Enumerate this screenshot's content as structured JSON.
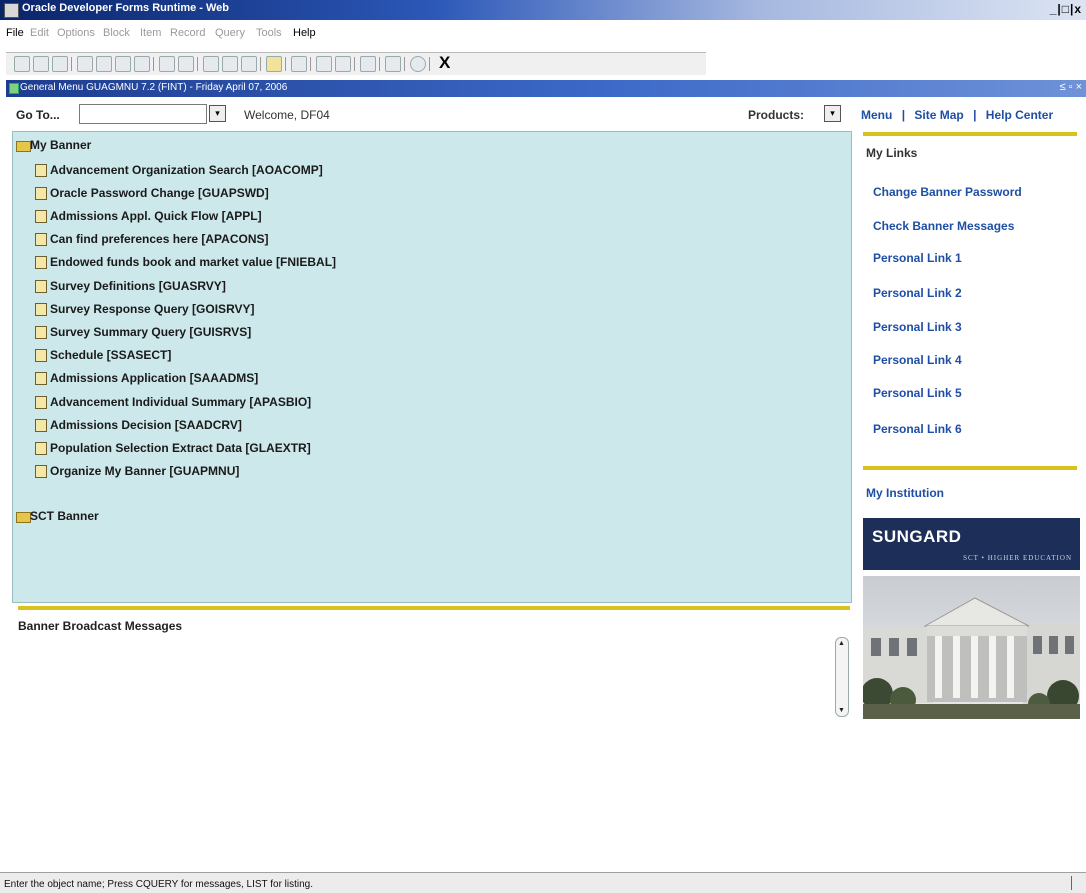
{
  "window": {
    "title": "Oracle Developer Forms Runtime - Web",
    "controls": "_|□|x"
  },
  "menubar": {
    "items": [
      {
        "label": "File",
        "enabled": true
      },
      {
        "label": "Edit",
        "enabled": false
      },
      {
        "label": "Options",
        "enabled": false
      },
      {
        "label": "Block",
        "enabled": false
      },
      {
        "label": "Item",
        "enabled": false
      },
      {
        "label": "Record",
        "enabled": false
      },
      {
        "label": "Query",
        "enabled": false
      },
      {
        "label": "Tools",
        "enabled": false
      },
      {
        "label": "Help",
        "enabled": true
      }
    ]
  },
  "toolbar": {
    "exit_label": "X"
  },
  "form_header": {
    "title": "General Menu GUAGMNU 7.2 (FINT) - Friday April 07, 2006",
    "controls": "≤ ▫ ×"
  },
  "goto": {
    "label": "Go To...",
    "value": "",
    "dropdown_glyph": "▾"
  },
  "welcome_text": "Welcome, DF04",
  "products": {
    "label": "Products:",
    "dropdown_glyph": "▾"
  },
  "top_links": {
    "menu": "Menu",
    "site_map": "Site Map",
    "help_center": "Help Center",
    "separator": "|"
  },
  "tree": {
    "my_banner": {
      "label": "My Banner",
      "items": [
        "Advancement Organization Search [AOACOMP]",
        "Oracle Password Change [GUAPSWD]",
        "Admissions Appl. Quick Flow [APPL]",
        "Can find preferences here [APACONS]",
        "Endowed funds book and market value [FNIEBAL]",
        "Survey Definitions [GUASRVY]",
        "Survey Response Query [GOISRVY]",
        "Survey Summary Query [GUISRVS]",
        "Schedule [SSASECT]",
        "Admissions Application [SAAADMS]",
        "Advancement Individual Summary [APASBIO]",
        "Admissions Decision [SAADCRV]",
        "Population Selection Extract Data [GLAEXTR]",
        "Organize My Banner [GUAPMNU]"
      ]
    },
    "sct_banner": {
      "label": "SCT Banner"
    }
  },
  "broadcast": {
    "label": "Banner Broadcast Messages",
    "scroll_up": "▲",
    "scroll_down": "▼"
  },
  "sidebar": {
    "my_links_title": "My Links",
    "links": [
      "Change Banner Password",
      "Check Banner Messages",
      "Personal Link 1",
      "Personal Link 2",
      "Personal Link 3",
      "Personal Link 4",
      "Personal Link 5",
      "Personal Link 6"
    ],
    "my_institution": "My Institution",
    "logo": {
      "brand": "SUNGARD",
      "tagline": "SCT • HIGHER EDUCATION"
    }
  },
  "status": {
    "message": "Enter the object name; Press CQUERY for messages, LIST for listing."
  },
  "colors": {
    "titlebar": "#0a246a",
    "tree_bg": "#cde8ea",
    "link": "#1f4fa3",
    "separator": "#d9c11e",
    "logo_bg": "#1d2f58"
  }
}
